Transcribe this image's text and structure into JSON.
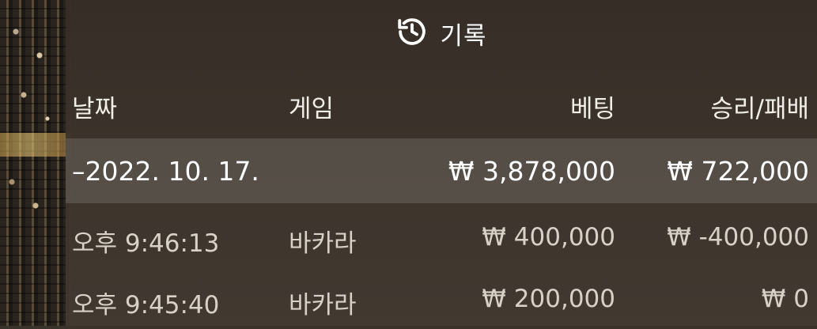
{
  "header": {
    "title": "기록",
    "icon": "history-icon"
  },
  "columns": {
    "date": "날짜",
    "game": "게임",
    "bet": "베팅",
    "result": "승리/패배"
  },
  "date_group": {
    "label": "–2022. 10. 17.",
    "bet_total": "₩ 3,878,000",
    "result_total": "₩ 722,000"
  },
  "rows": [
    {
      "time": "오후 9:46:13",
      "game": "바카라",
      "bet": "₩ 400,000",
      "result": "₩ -400,000"
    },
    {
      "time": "오후 9:45:40",
      "game": "바카라",
      "bet": "₩ 200,000",
      "result": "₩ 0"
    }
  ]
}
